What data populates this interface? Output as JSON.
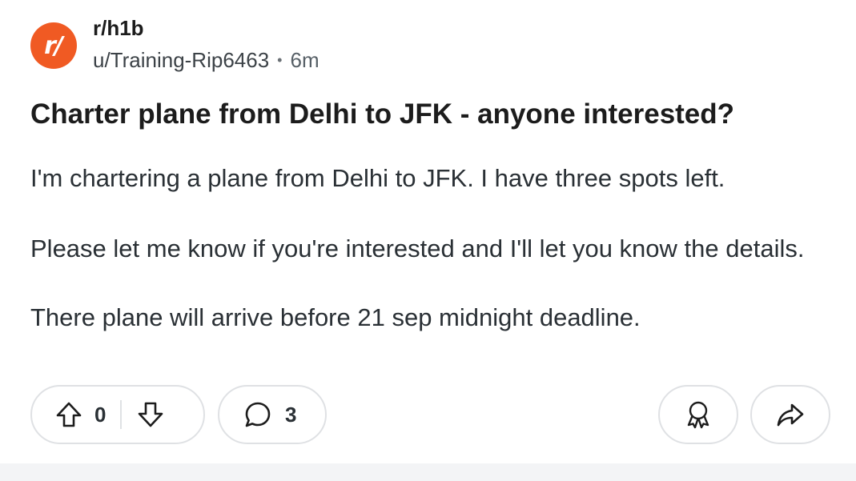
{
  "post": {
    "subreddit": "r/h1b",
    "author": "u/Training-Rip6463",
    "separator": "•",
    "age": "6m",
    "title": "Charter plane from Delhi to JFK - anyone interested?",
    "body": [
      "I'm chartering a plane from Delhi to JFK. I have three spots left.",
      "Please let me know if you're interested and I'll let you know the details.",
      "There plane will arrive before 21 sep midnight deadline."
    ]
  },
  "avatar": {
    "text": "r/",
    "color": "#f05a23"
  },
  "actions": {
    "vote_count": "0",
    "comment_count": "3",
    "icons": [
      "upvote-icon",
      "downvote-icon",
      "comment-icon",
      "award-icon",
      "share-icon"
    ]
  },
  "colors": {
    "accent": "#f05a23",
    "border": "#dfe1e4",
    "text": "#1c1c1c"
  }
}
